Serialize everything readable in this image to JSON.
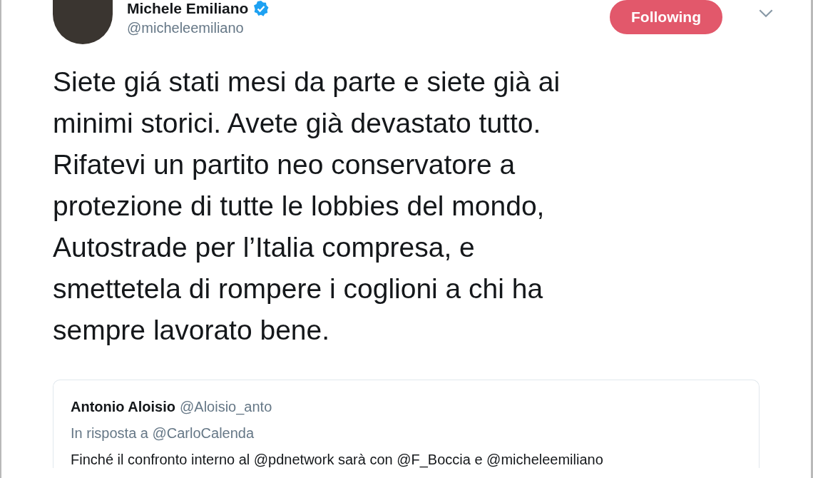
{
  "author": {
    "name": "Michele Emiliano",
    "handle": "@micheleemiliano",
    "verified": true
  },
  "follow_button": {
    "label": "Following",
    "selected": true
  },
  "tweet_text": "Siete giá stati mesi da parte e siete già ai\nminimi storici. Avete già devastato tutto.\nRifatevi un partito neo conservatore a\nprotezione di tutte le lobbies del mondo,\nAutostrade per l’Italia compresa, e\nsmettetela di rompere i coglioni a chi ha\nsempre lavorato bene.",
  "quoted_tweet": {
    "name": "Antonio Aloisio",
    "handle": "@Aloisio_anto",
    "reply_to": "In risposta a @CarloCalenda",
    "text": "Finché il confronto interno al @pdnetwork  sarà con @F_Boccia  e @micheleemiliano"
  }
}
